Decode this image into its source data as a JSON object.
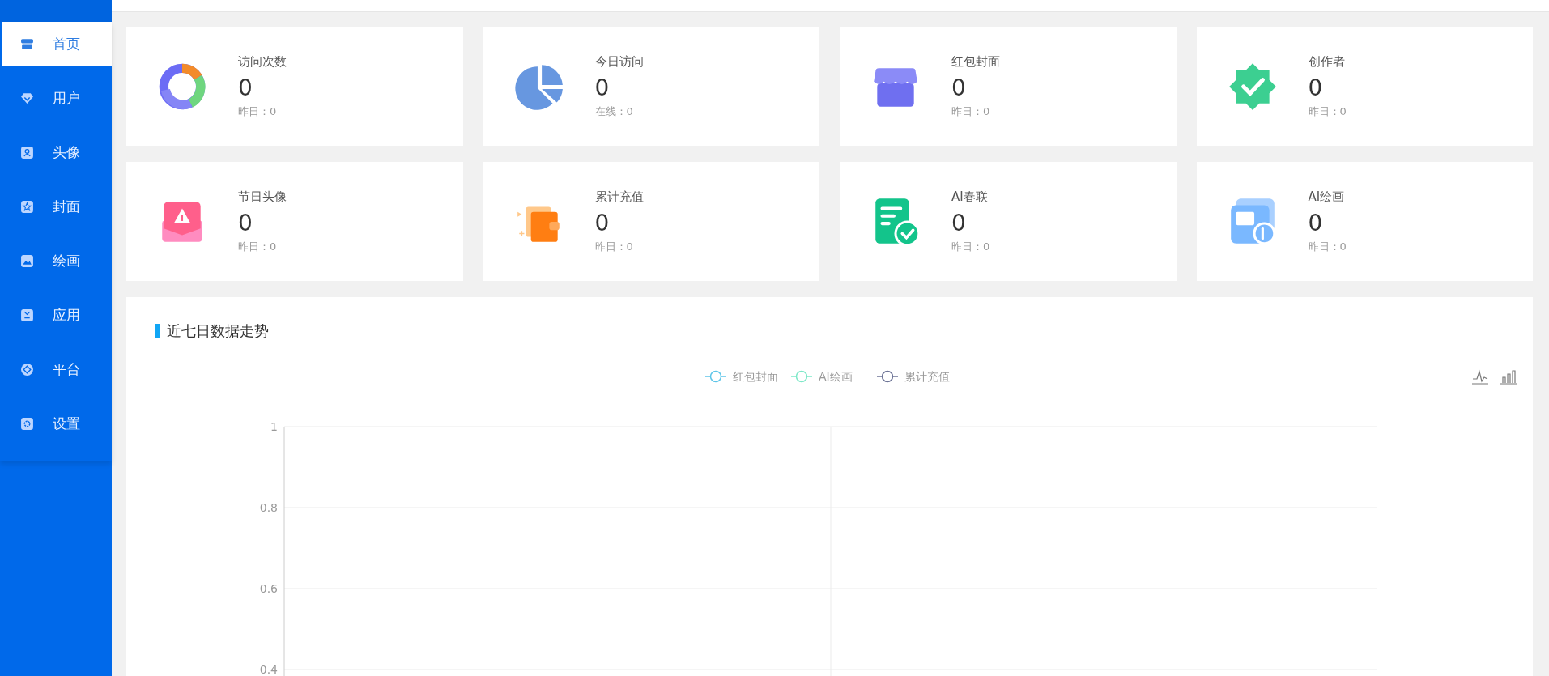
{
  "sidebar": {
    "items": [
      {
        "label": "首页",
        "selected": true
      },
      {
        "label": "用户",
        "selected": false
      },
      {
        "label": "头像",
        "selected": false
      },
      {
        "label": "封面",
        "selected": false
      },
      {
        "label": "绘画",
        "selected": false
      },
      {
        "label": "应用",
        "selected": false
      },
      {
        "label": "平台",
        "selected": false
      },
      {
        "label": "设置",
        "selected": false
      }
    ]
  },
  "stats": [
    {
      "title": "访问次数",
      "value": "0",
      "sub": "昨日：0"
    },
    {
      "title": "今日访问",
      "value": "0",
      "sub": "在线：0"
    },
    {
      "title": "红包封面",
      "value": "0",
      "sub": "昨日：0"
    },
    {
      "title": "创作者",
      "value": "0",
      "sub": "昨日：0"
    },
    {
      "title": "节日头像",
      "value": "0",
      "sub": "昨日：0"
    },
    {
      "title": "累计充值",
      "value": "0",
      "sub": "昨日：0"
    },
    {
      "title": "AI春联",
      "value": "0",
      "sub": "昨日：0"
    },
    {
      "title": "AI绘画",
      "value": "0",
      "sub": "昨日：0"
    }
  ],
  "trend": {
    "title": "近七日数据走势",
    "chart_data": {
      "type": "line",
      "ylim": [
        0.4,
        1
      ],
      "yticks": [
        0.4,
        0.6,
        0.8,
        1
      ],
      "series": [
        {
          "name": "红包封面",
          "color": "#5ec5e8"
        },
        {
          "name": "AI绘画",
          "color": "#7ee8c8"
        },
        {
          "name": "累计充值",
          "color": "#6e7597"
        }
      ]
    }
  }
}
